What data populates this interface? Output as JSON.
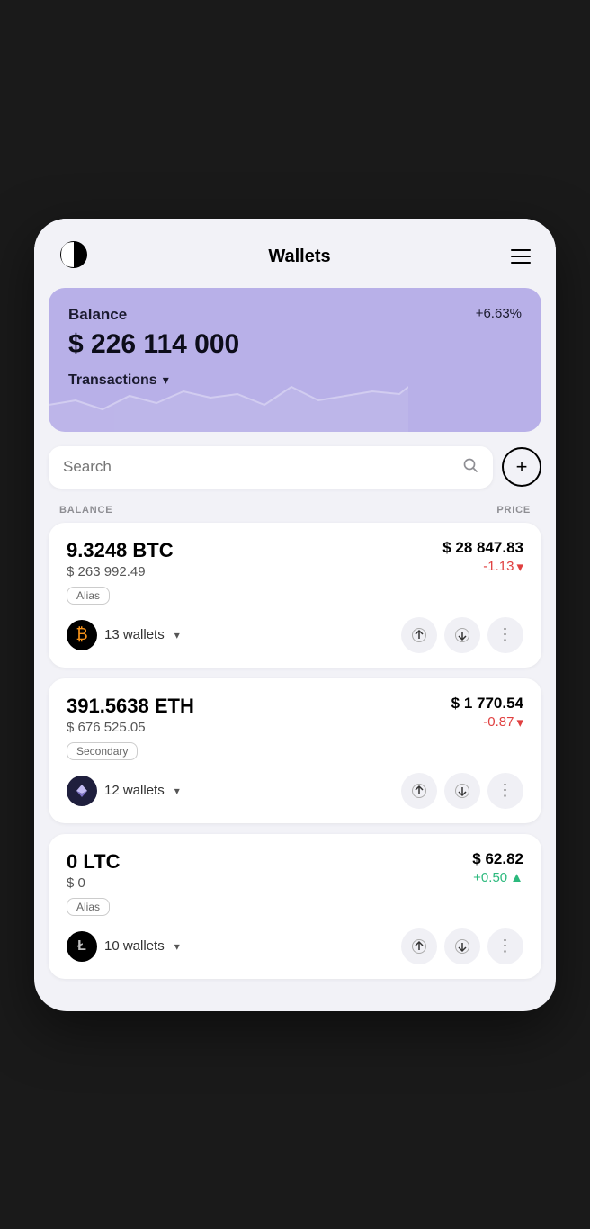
{
  "header": {
    "title": "Wallets",
    "logo": "half-circle",
    "menu": "menu-icon"
  },
  "balance_card": {
    "label": "Balance",
    "percent": "+6.63%",
    "amount": "$ 226 114 000",
    "transactions_label": "Transactions"
  },
  "search": {
    "placeholder": "Search",
    "add_button": "+"
  },
  "columns": {
    "left": "BALANCE",
    "right": "PRICE"
  },
  "coins": [
    {
      "id": "btc",
      "amount": "9.3248 BTC",
      "usd_value": "$ 263 992.49",
      "alias": "Alias",
      "wallets": "13 wallets",
      "price": "$ 28 847.83",
      "change": "-1.13",
      "change_dir": "negative",
      "icon_symbol": "₿",
      "icon_class": "btc-icon"
    },
    {
      "id": "eth",
      "amount": "391.5638 ETH",
      "usd_value": "$ 676 525.05",
      "alias": "Secondary",
      "wallets": "12 wallets",
      "price": "$ 1 770.54",
      "change": "-0.87",
      "change_dir": "negative",
      "icon_symbol": "◆",
      "icon_class": "eth-icon"
    },
    {
      "id": "ltc",
      "amount": "0 LTC",
      "usd_value": "$ 0",
      "alias": "Alias",
      "wallets": "10 wallets",
      "price": "$ 62.82",
      "change": "+0.50",
      "change_dir": "positive",
      "icon_symbol": "Ł",
      "icon_class": "ltc-icon"
    }
  ]
}
